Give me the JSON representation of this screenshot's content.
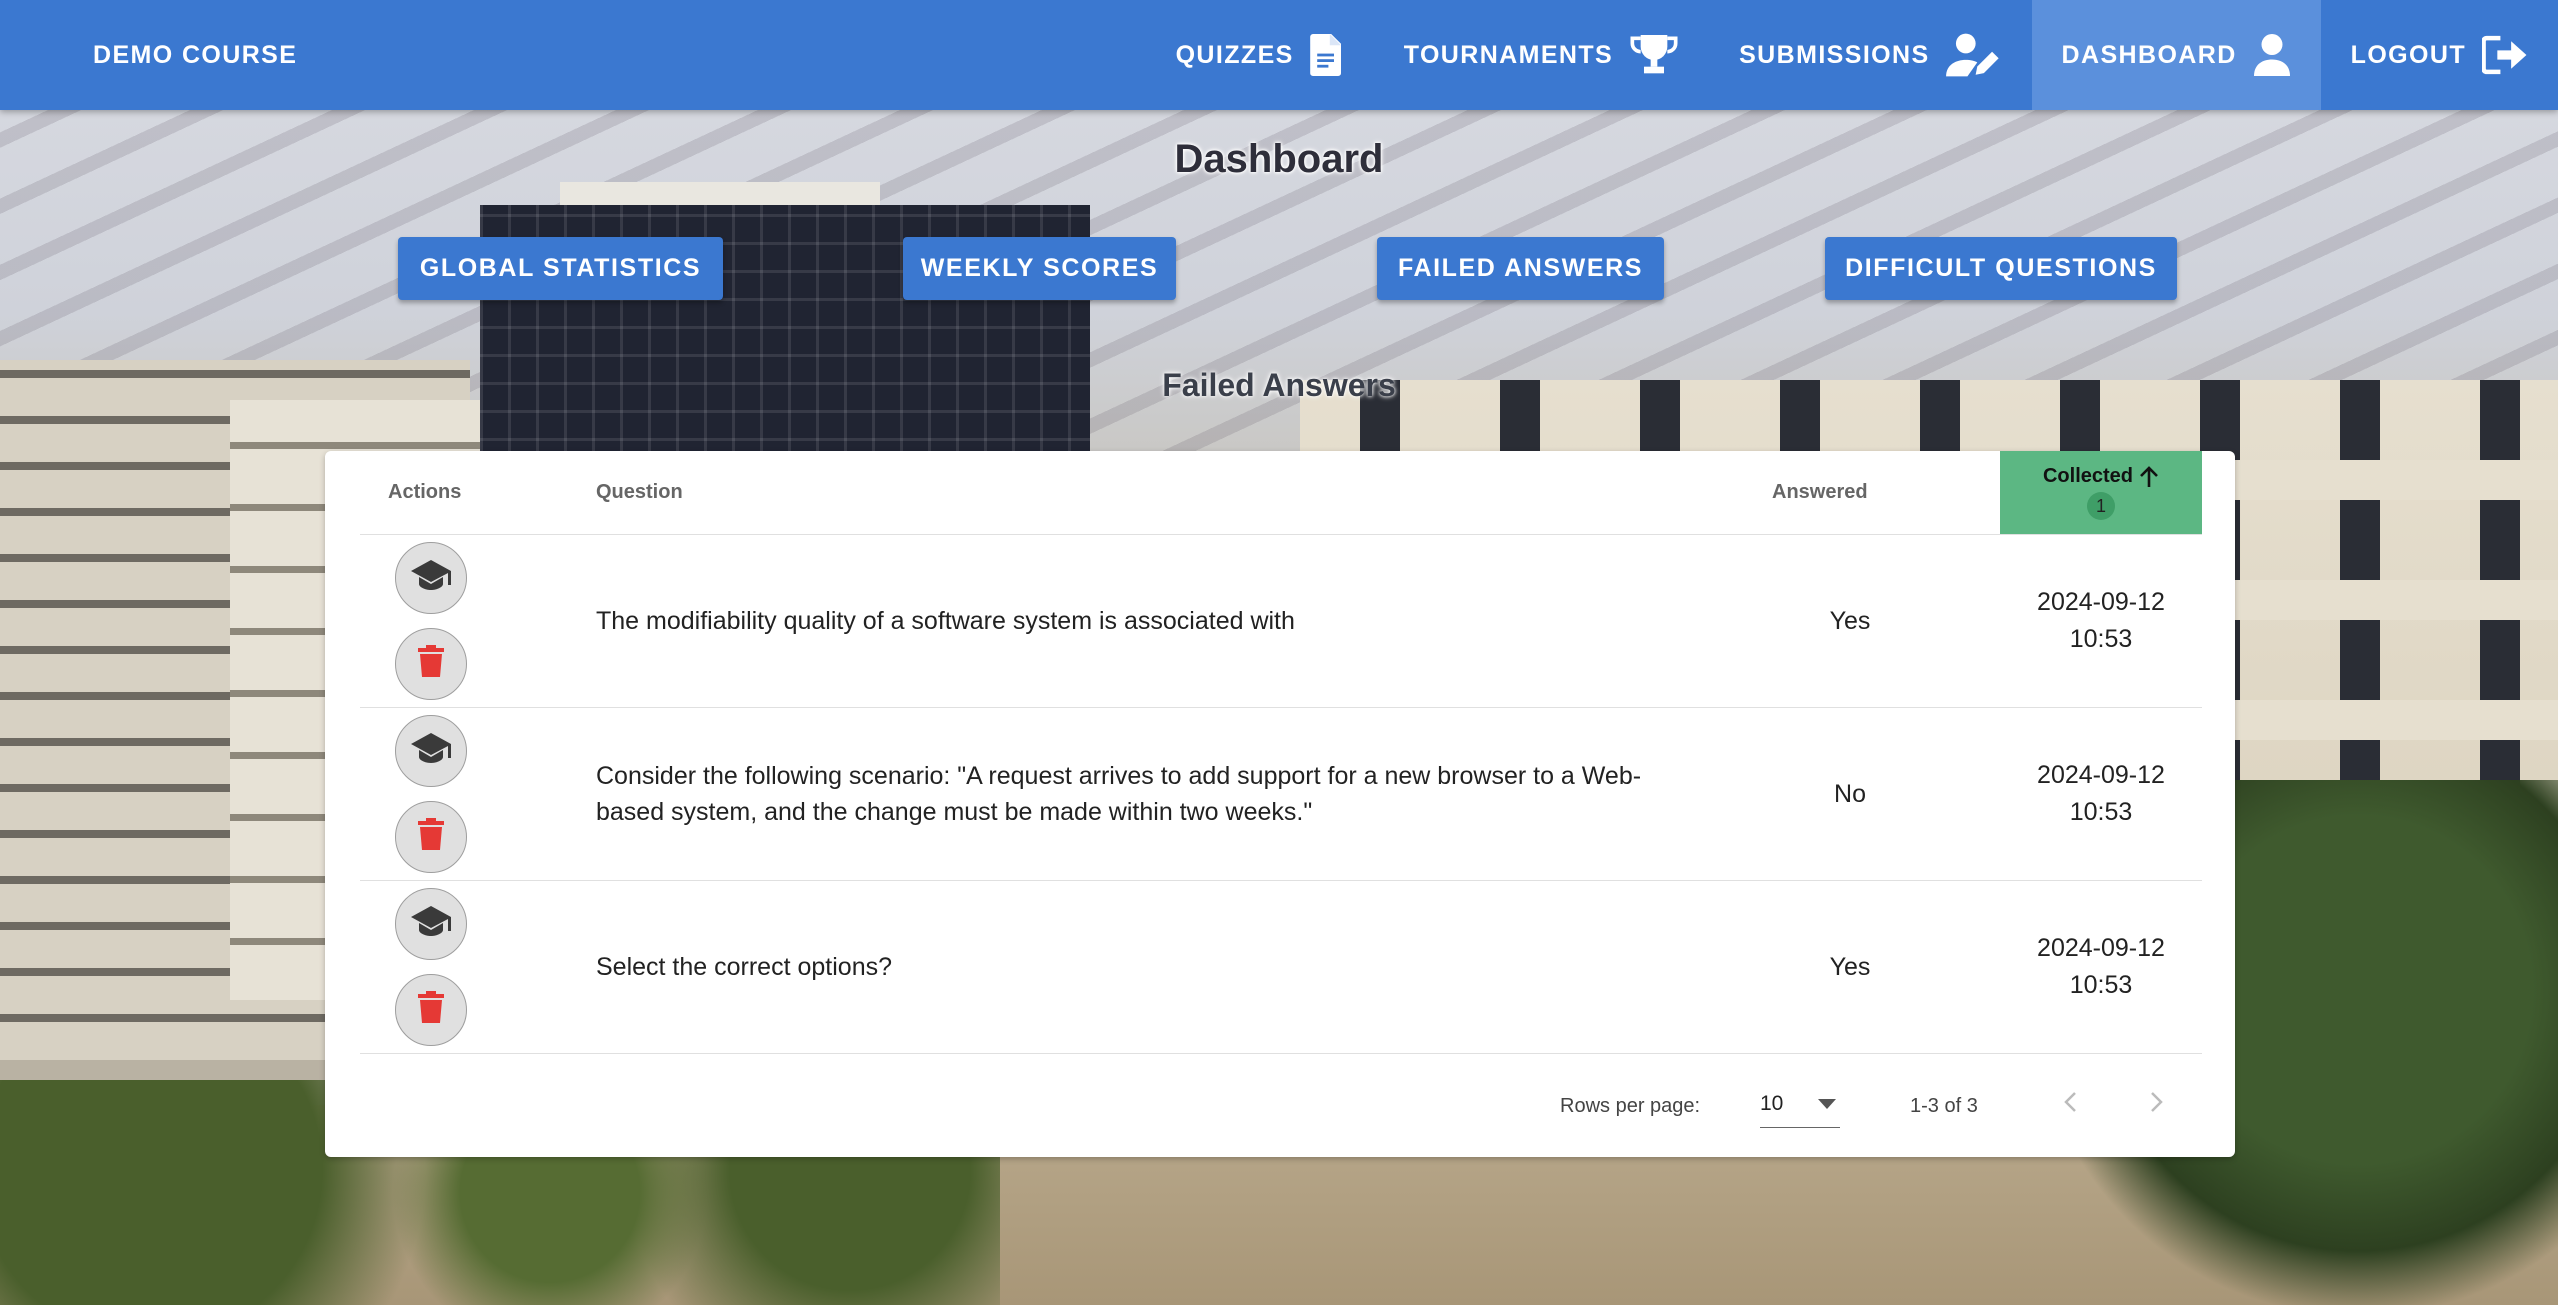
{
  "header": {
    "course_title": "DEMO COURSE",
    "nav": [
      {
        "label": "QUIZZES",
        "icon": "file-document-icon"
      },
      {
        "label": "TOURNAMENTS",
        "icon": "trophy-icon"
      },
      {
        "label": "SUBMISSIONS",
        "icon": "account-edit-icon"
      },
      {
        "label": "DASHBOARD",
        "icon": "account-icon",
        "active": true
      },
      {
        "label": "LOGOUT",
        "icon": "logout-icon"
      }
    ]
  },
  "page": {
    "title": "Dashboard",
    "tabs": [
      "GLOBAL STATISTICS",
      "WEEKLY SCORES",
      "FAILED ANSWERS",
      "DIFFICULT QUESTIONS"
    ],
    "section_title": "Failed Answers"
  },
  "table": {
    "headers": {
      "actions": "Actions",
      "question": "Question",
      "answered": "Answered",
      "collected": "Collected",
      "sort_order": "1"
    },
    "rows": [
      {
        "question": "The modifiability quality of a software system is associated with",
        "answered": "Yes",
        "date": "2024-09-12",
        "time": "10:53"
      },
      {
        "question": "Consider the following scenario: \"A request arrives to add support for a new browser to a Web-based system, and the change must be made within two weeks.\"",
        "answered": "No",
        "date": "2024-09-12",
        "time": "10:53"
      },
      {
        "question": "Select the correct options?",
        "answered": "Yes",
        "date": "2024-09-12",
        "time": "10:53"
      }
    ],
    "footer": {
      "rows_per_page_label": "Rows per page:",
      "rows_per_page_value": "10",
      "range_text": "1-3 of 3"
    }
  },
  "colors": {
    "primary": "#3b78d0",
    "active_nav": "#5b90dc",
    "sorted_header": "#5cb783",
    "delete_icon": "#e53935"
  }
}
